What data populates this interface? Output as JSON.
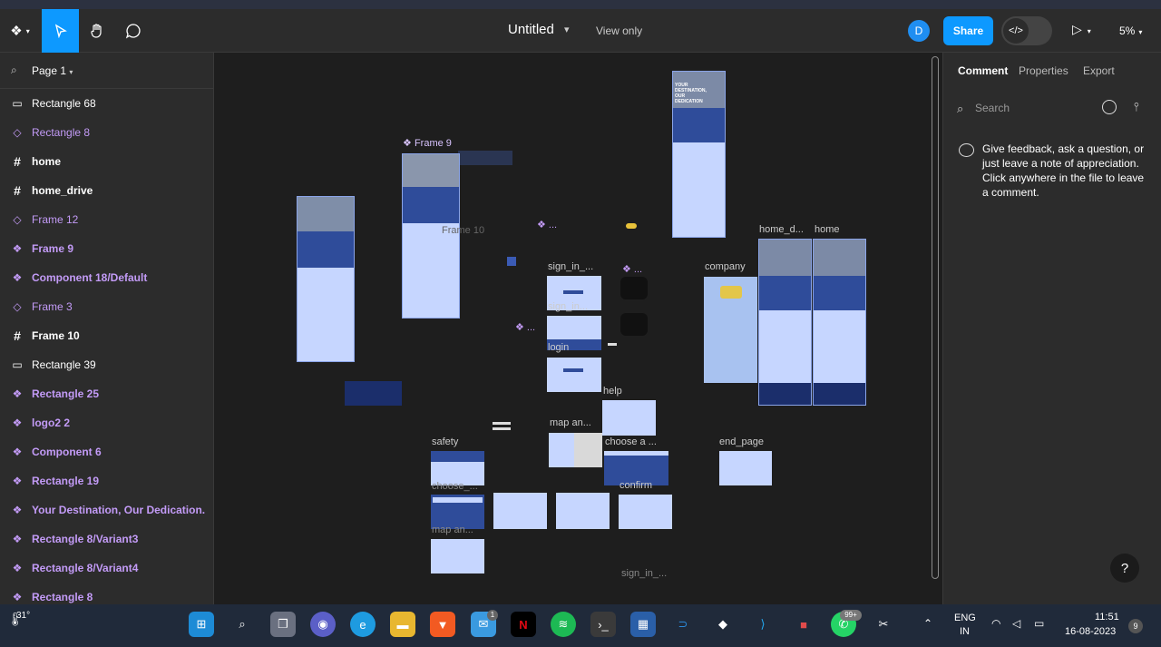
{
  "toolbar": {
    "file_title": "Untitled",
    "view_mode": "View only",
    "avatar_letter": "D",
    "share_label": "Share",
    "devmode_icon": "</>",
    "zoom": "5%"
  },
  "left": {
    "page": "Page 1",
    "layers": [
      {
        "name": "Rectangle 68",
        "icon": "rectangle-icon",
        "color": "white",
        "bold": false
      },
      {
        "name": "Rectangle 8",
        "icon": "instance-icon",
        "color": "purple",
        "bold": false
      },
      {
        "name": "home",
        "icon": "frame-icon",
        "color": "white",
        "bold": true
      },
      {
        "name": "home_drive",
        "icon": "frame-icon",
        "color": "white",
        "bold": true
      },
      {
        "name": "Frame 12",
        "icon": "instance-icon",
        "color": "purple",
        "bold": false
      },
      {
        "name": "Frame 9",
        "icon": "component-icon",
        "color": "purple",
        "bold": true
      },
      {
        "name": "Component 18/Default",
        "icon": "component-icon",
        "color": "purple",
        "bold": true
      },
      {
        "name": "Frame 3",
        "icon": "instance-icon",
        "color": "purple",
        "bold": false
      },
      {
        "name": "Frame 10",
        "icon": "frame-icon",
        "color": "white",
        "bold": true
      },
      {
        "name": "Rectangle 39",
        "icon": "rectangle-icon",
        "color": "white",
        "bold": false
      },
      {
        "name": "Rectangle 25",
        "icon": "component-icon",
        "color": "purple",
        "bold": true
      },
      {
        "name": "logo2 2",
        "icon": "component-icon",
        "color": "purple",
        "bold": true
      },
      {
        "name": "Component 6",
        "icon": "component-icon",
        "color": "purple",
        "bold": true
      },
      {
        "name": "Rectangle 19",
        "icon": "component-icon",
        "color": "purple",
        "bold": true
      },
      {
        "name": "Your Destination, Our Dedication.",
        "icon": "component-icon",
        "color": "purple",
        "bold": true
      },
      {
        "name": "Rectangle 8/Variant3",
        "icon": "component-icon",
        "color": "purple",
        "bold": true
      },
      {
        "name": "Rectangle 8/Variant4",
        "icon": "component-icon",
        "color": "purple",
        "bold": true
      },
      {
        "name": "Rectangle 8",
        "icon": "component-icon",
        "color": "purple",
        "bold": true
      }
    ]
  },
  "canvas": {
    "labels": {
      "frame9": "Frame 9",
      "frame10": "Frame 10",
      "sign_in_1": "sign_in_...",
      "sign_in_2": "sign_in...",
      "login": "login",
      "company": "company",
      "home_d": "home_d...",
      "home": "home",
      "help": "help",
      "map_an_1": "map an...",
      "choose_a": "choose a ...",
      "end_page": "end_page",
      "safety": "safety",
      "choose_2": "choose_...",
      "confirm": "confirm",
      "map_an_2": "map an...",
      "sign_in_3": "sign_in_...",
      "dots": "...",
      "hero_text": "YOUR DESTINATION, OUR DEDICATION"
    }
  },
  "right": {
    "tabs": [
      "Comment",
      "Properties",
      "Export"
    ],
    "search_placeholder": "Search",
    "help_text": "Give feedback, ask a question, or just leave a note of appreciation. Click anywhere in the file to leave a comment.",
    "help_button": "?"
  },
  "taskbar": {
    "temperature": "31°",
    "mail_badge": "1",
    "whatsapp_badge": "99+",
    "lang_line1": "ENG",
    "lang_line2": "IN",
    "time": "11:51",
    "date": "16-08-2023",
    "notif_count": "9"
  },
  "colors": {
    "accent": "#0d99ff",
    "component_purple": "#c39bf7",
    "frame_pale": "#c6d6ff",
    "frame_navy": "#1b2e6b"
  }
}
